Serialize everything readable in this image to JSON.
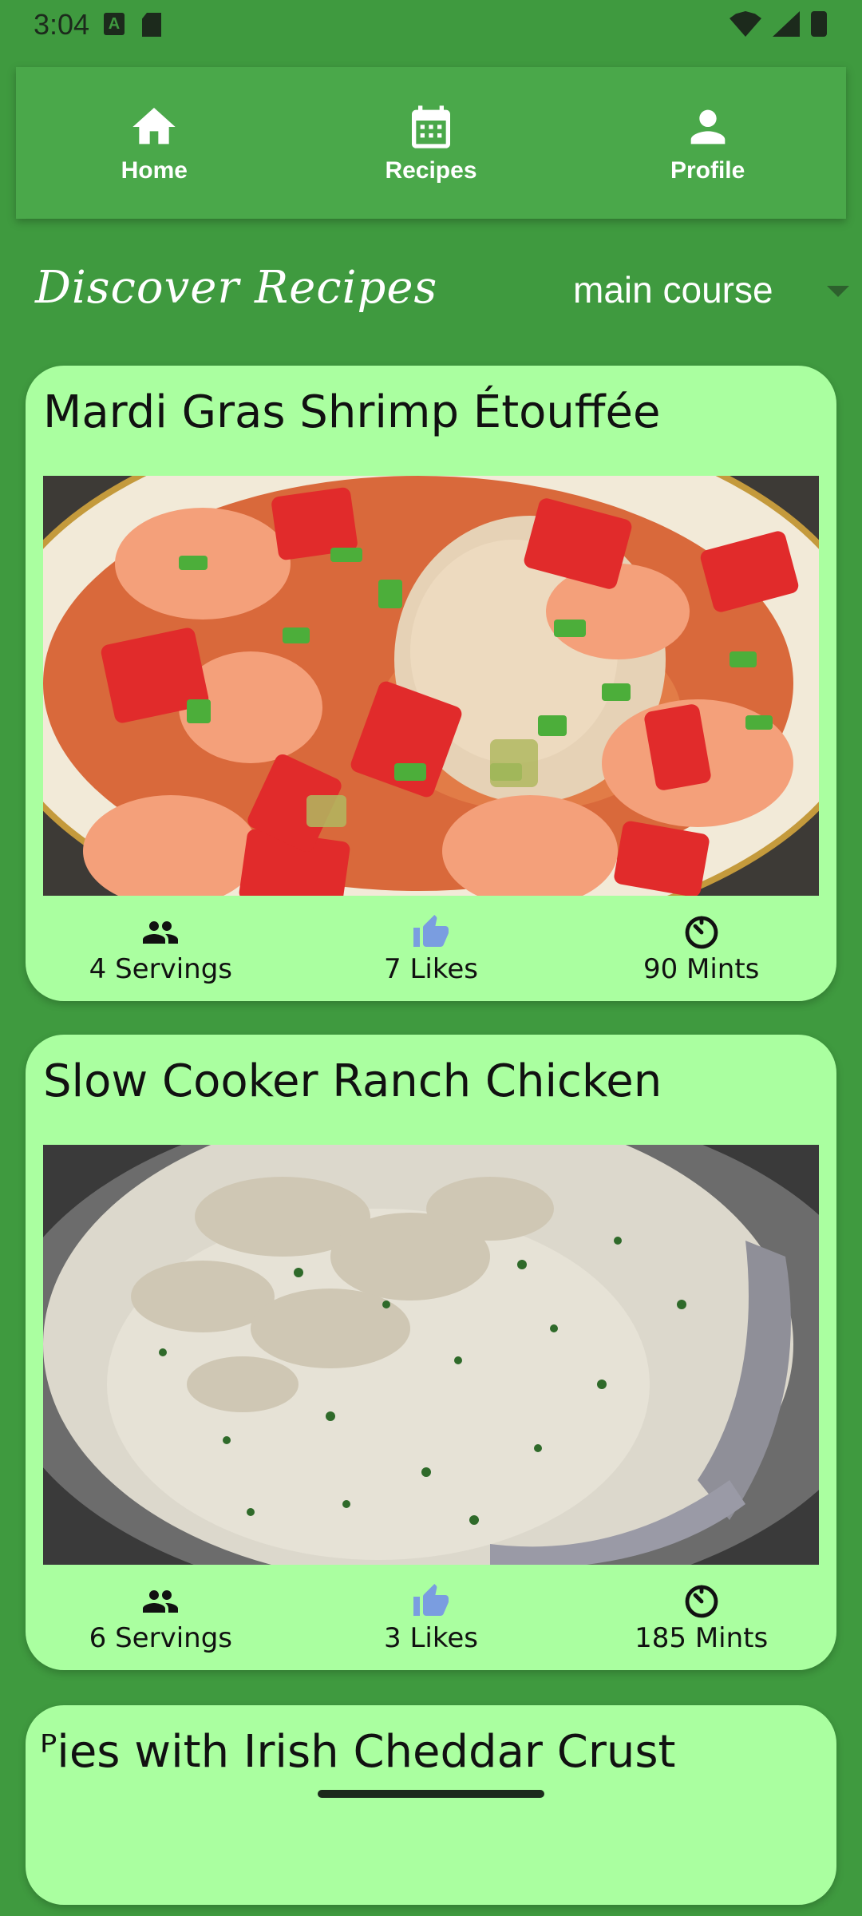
{
  "status": {
    "time": "3:04",
    "icon_a": "A"
  },
  "nav": {
    "items": [
      {
        "label": "Home",
        "icon": "home-icon"
      },
      {
        "label": "Recipes",
        "icon": "calendar-icon"
      },
      {
        "label": "Profile",
        "icon": "person-icon"
      }
    ]
  },
  "header": {
    "title": "Discover Recipes",
    "category": "main course"
  },
  "recipes": [
    {
      "title": "Mardi Gras Shrimp Étouffée",
      "servings": "4 Servings",
      "likes": "7 Likes",
      "time": "90 Mints"
    },
    {
      "title": "Slow Cooker Ranch Chicken",
      "servings": "6 Servings",
      "likes": "3 Likes",
      "time": "185 Mints"
    },
    {
      "title": "ᴾies with Irish Cheddar Crust"
    }
  ],
  "colors": {
    "background": "#3f9a3f",
    "navbar": "#4aa84a",
    "card": "#aaffa0",
    "like_icon": "#7a9de0"
  }
}
